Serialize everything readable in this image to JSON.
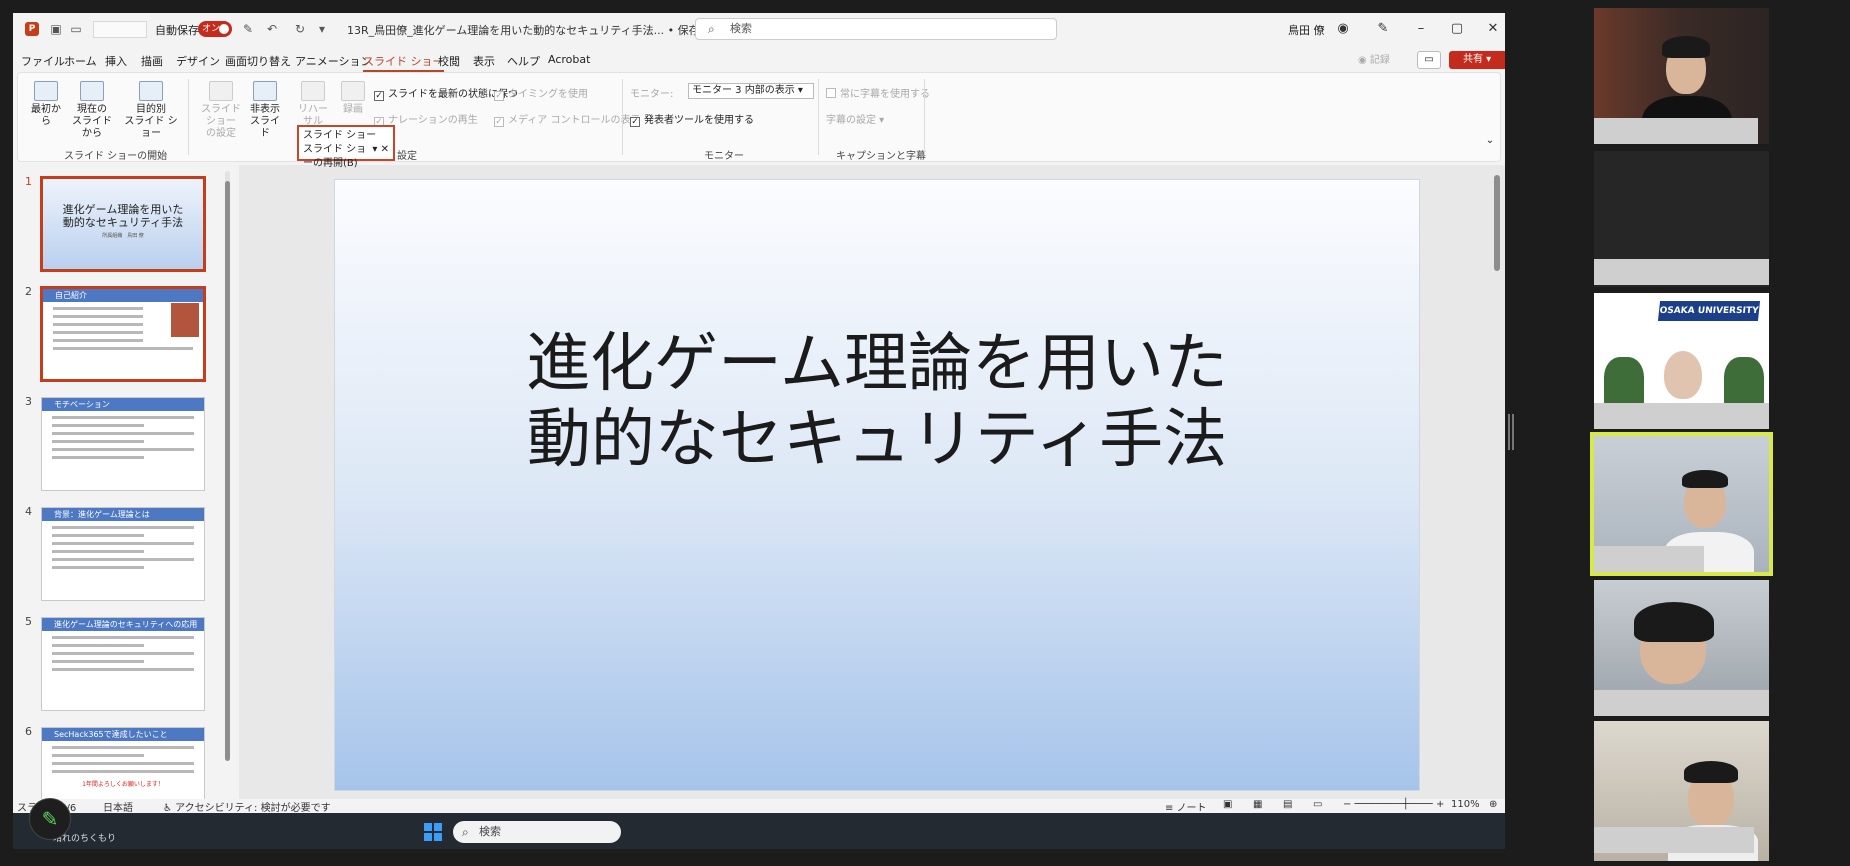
{
  "titlebar": {
    "autosave_label": "自動保存",
    "autosave_toggle": "オン",
    "doc_title": "13R_鳥田僚_進化ゲーム理論を用いた動的なセキュリティ手法... • 保存済み ⌵",
    "search_placeholder": "検索",
    "user_name": "鳥田 僚"
  },
  "menu": {
    "items": [
      "ファイル",
      "ホーム",
      "挿入",
      "描画",
      "デザイン",
      "画面切り替え",
      "アニメーション",
      "スライド ショー",
      "校閲",
      "表示",
      "ヘルプ",
      "Acrobat"
    ],
    "active": "スライド ショー",
    "record_label": "記録",
    "share_label": "共有"
  },
  "ribbon": {
    "from_start": "最初から",
    "from_current": "現在の\nスライドから",
    "custom_show": "目的別\nスライド ショー",
    "group_start": "スライド ショーの開始",
    "setup_show": "スライド ショー\nの設定",
    "hide_slide": "非表示\nスライド",
    "rehearse": "リハーサル",
    "record": "録画",
    "keep_updated": "スライドを最新の状態に保つ",
    "use_timings": "タイミングを使用",
    "play_narration": "ナレーションの再生",
    "media_controls": "メディア コントロールの表示",
    "group_setup": "設定",
    "monitor_label": "モニター:",
    "monitor_value": "モニター 3 内部の表示",
    "presenter_view": "発表者ツールを使用する",
    "group_monitor": "モニター",
    "always_subtitles": "常に字幕を使用する",
    "subtitle_settings": "字幕の設定",
    "group_captions": "キャプションと字幕",
    "popup_title": "スライド ショー",
    "popup_item": "スライド ショーの再開(B)"
  },
  "thumbnails": [
    {
      "num": "1",
      "title": "進化ゲーム理論を用いた\n動的なセキュリティ手法",
      "sub": "所属組織　鳥田 僚"
    },
    {
      "num": "2",
      "title": "自己紹介"
    },
    {
      "num": "3",
      "title": "モチベーション"
    },
    {
      "num": "4",
      "title": "背景：進化ゲーム理論とは"
    },
    {
      "num": "5",
      "title": "進化ゲーム理論のセキュリティへの応用"
    },
    {
      "num": "6",
      "title": "SecHack365で達成したいこと",
      "footer": "1年間よろしくお願いします！"
    }
  ],
  "slide": {
    "title_line1": "進化ゲーム理論を用いた",
    "title_line2": "動的なセキュリティ手法"
  },
  "statusbar": {
    "slide_info": "スライド 1/6",
    "language": "日本語",
    "accessibility": "アクセシビリティ: 検討が必要です",
    "notes": "ノート",
    "zoom": "110%"
  },
  "taskbar": {
    "weather": "晴れのちくもり",
    "search_placeholder": "検索"
  },
  "video": {
    "banner": "OSAKA UNIVERSITY"
  },
  "colors": {
    "accent": "#c43e1c",
    "speaking_outline": "#d7e84a",
    "thumb_header": "#4d78c4"
  }
}
